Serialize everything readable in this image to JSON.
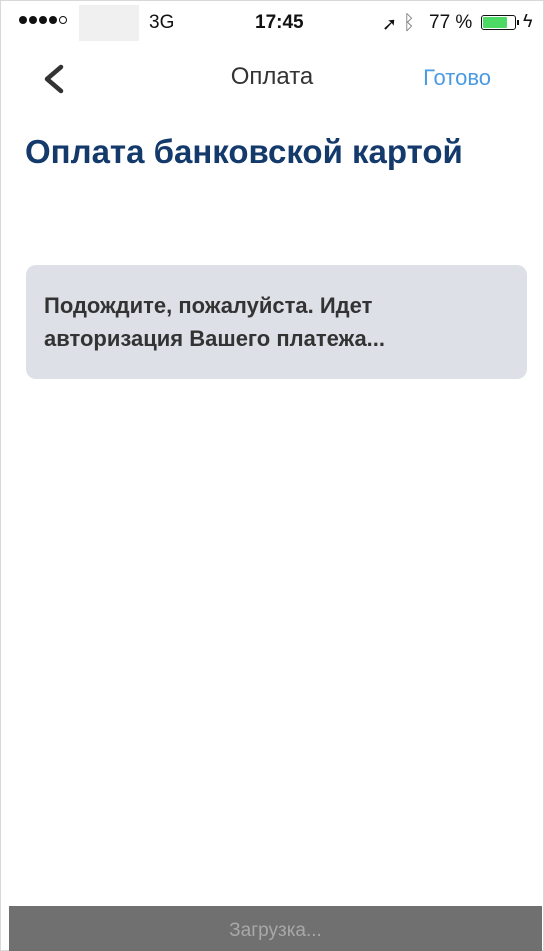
{
  "status_bar": {
    "network": "3G",
    "time": "17:45",
    "battery_percent": "77 %",
    "battery_level": 0.77,
    "icons": [
      "signal-dots-icon",
      "location-arrow-icon",
      "bluetooth-icon",
      "battery-icon",
      "charging-bolt-icon"
    ]
  },
  "nav": {
    "back_icon": "chevron-left-icon",
    "title": "Оплата",
    "done_label": "Готово"
  },
  "main": {
    "title": "Оплата банковской картой",
    "notice": "Подождите, пожалуйста. Идет авторизация Вашего платежа..."
  },
  "footer": {
    "loading_text": "Загрузка..."
  },
  "colors": {
    "accent": "#4a9be0",
    "title": "#143a6b",
    "notice_bg": "#dde0e7",
    "loading_bar_bg": "#707070",
    "battery": "#4cd964"
  }
}
